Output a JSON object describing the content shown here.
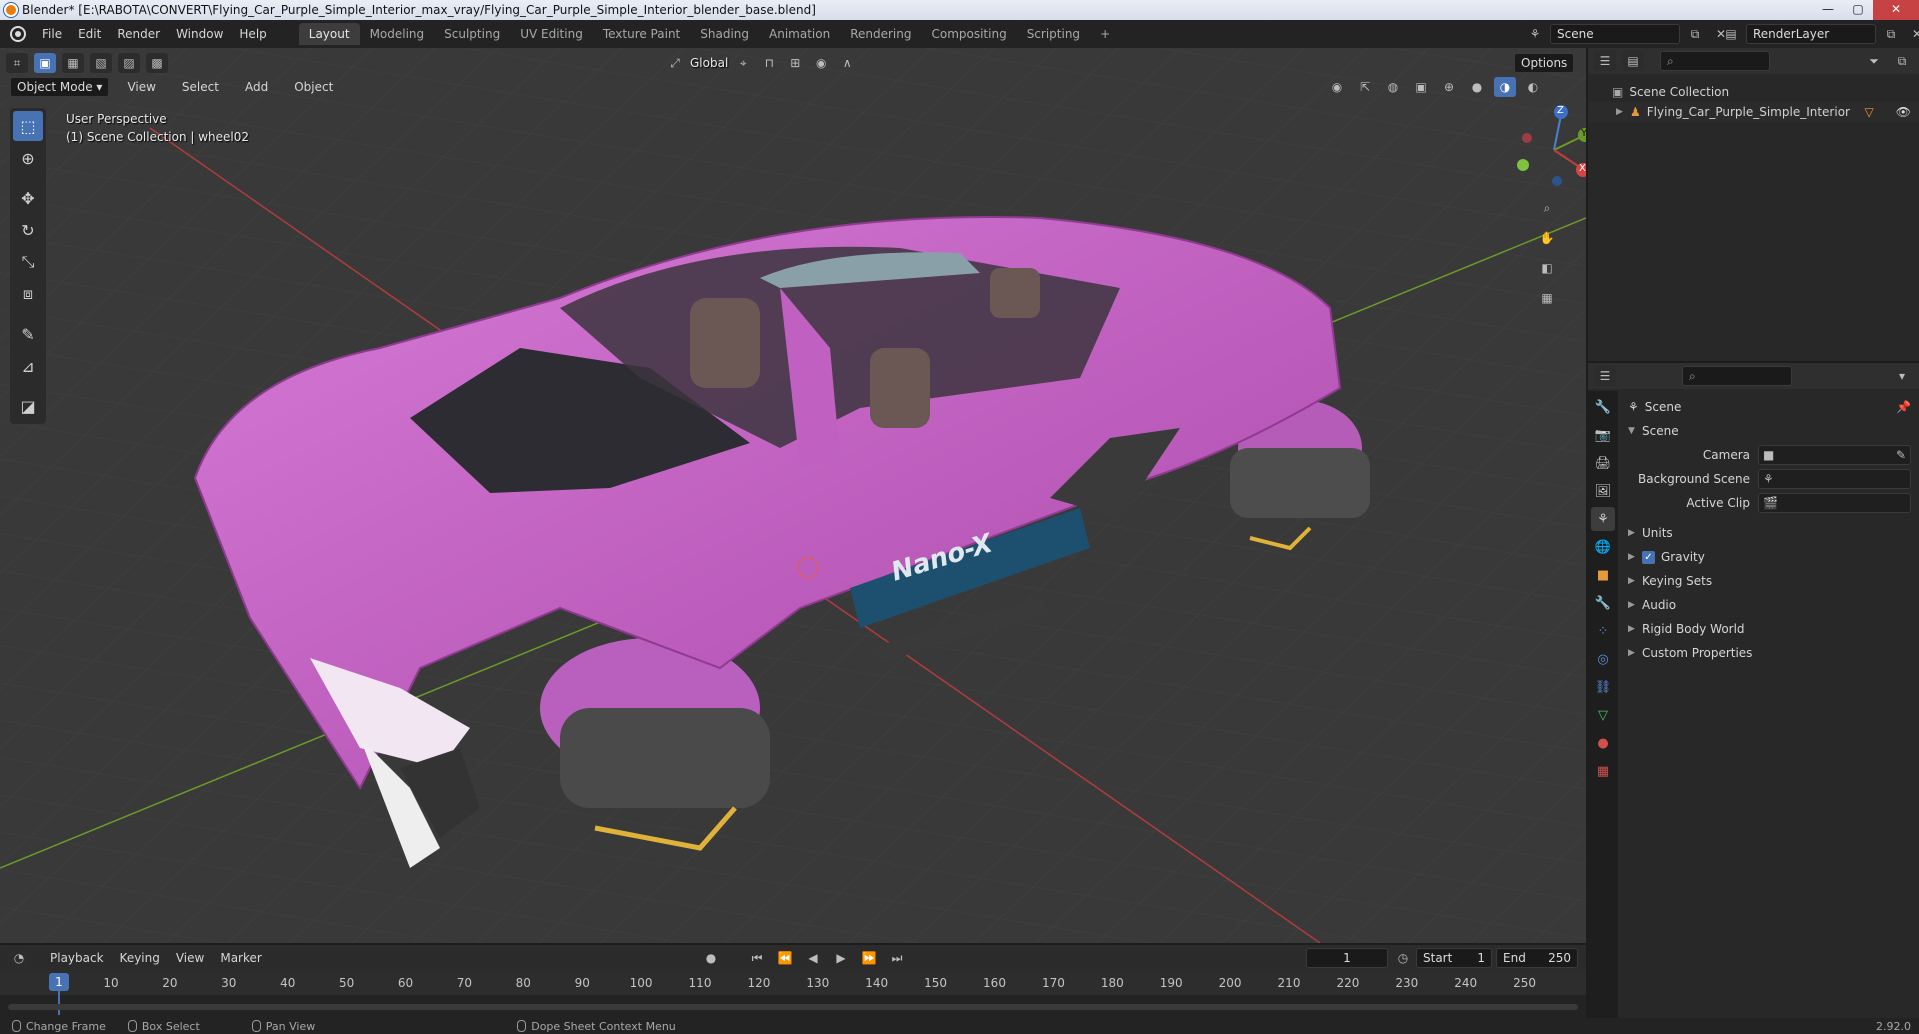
{
  "window": {
    "title": "Blender* [E:\\RABOTA\\CONVERT\\Flying_Car_Purple_Simple_Interior_max_vray/Flying_Car_Purple_Simple_Interior_blender_base.blend]",
    "buttons": [
      "—",
      "▢",
      "✕"
    ]
  },
  "menu": [
    "File",
    "Edit",
    "Render",
    "Window",
    "Help"
  ],
  "workspaces": [
    "Layout",
    "Modeling",
    "Sculpting",
    "UV Editing",
    "Texture Paint",
    "Shading",
    "Animation",
    "Rendering",
    "Compositing",
    "Scripting"
  ],
  "active_workspace": "Layout",
  "scene_field": "Scene",
  "view_layer_field": "RenderLayer",
  "viewport": {
    "mode": "Object Mode",
    "header_menu": [
      "View",
      "Select",
      "Add",
      "Object"
    ],
    "orientation": "Global",
    "options_label": "Options",
    "overlay_line1": "User Perspective",
    "overlay_line2": "(1) Scene Collection | wheel02",
    "car_label": "Nano-X",
    "colors": {
      "background": "#393939",
      "grid": "#444444",
      "car_body": "#c35fc4",
      "x_axis": "#c43c3c",
      "y_axis": "#6c9a2a"
    },
    "gizmo": {
      "x": "X",
      "y": "Y",
      "z": "Z"
    }
  },
  "toolbar_icons": [
    "select-box-icon",
    "cursor-icon",
    "move-icon",
    "rotate-icon",
    "scale-icon",
    "transform-icon",
    "annotate-icon",
    "measure-icon",
    "add-cube-icon"
  ],
  "outliner": {
    "root": "Scene Collection",
    "items": [
      {
        "label": "Flying_Car_Purple_Simple_Interior"
      }
    ]
  },
  "properties": {
    "context": "Scene",
    "section": "Scene",
    "fields": [
      {
        "label": "Camera",
        "value": ""
      },
      {
        "label": "Background Scene",
        "value": ""
      },
      {
        "label": "Active Clip",
        "value": ""
      }
    ],
    "subpanels": [
      "Units",
      "Gravity",
      "Keying Sets",
      "Audio",
      "Rigid Body World",
      "Custom Properties"
    ],
    "gravity_checked": true
  },
  "timeline": {
    "menus": [
      "Playback",
      "Keying",
      "View",
      "Marker"
    ],
    "current_frame": "1",
    "start_label": "Start",
    "start_value": "1",
    "end_label": "End",
    "end_value": "250",
    "ticks": [
      "1",
      "10",
      "20",
      "30",
      "40",
      "50",
      "60",
      "70",
      "80",
      "90",
      "100",
      "110",
      "120",
      "130",
      "140",
      "150",
      "160",
      "170",
      "180",
      "190",
      "200",
      "210",
      "220",
      "230",
      "240",
      "250"
    ]
  },
  "statusbar": {
    "items": [
      "Change Frame",
      "Box Select",
      "Pan View",
      "Dope Sheet Context Menu"
    ],
    "version": "2.92.0"
  }
}
